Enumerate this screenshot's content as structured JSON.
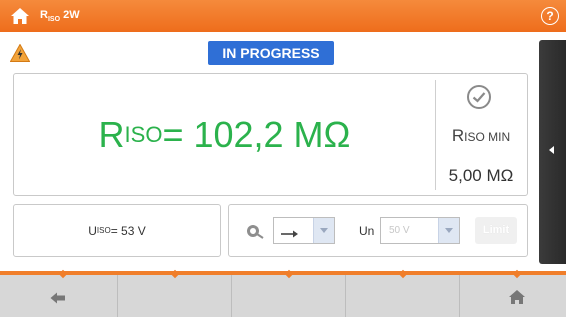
{
  "topbar": {
    "title_main": "R",
    "title_sub": "ISO",
    "title_rest": " 2W",
    "help_label": "?"
  },
  "status": {
    "label": "IN PROGRESS"
  },
  "result": {
    "symbol": "R",
    "symbol_sub": "ISO",
    "value_text": " = 102,2 MΩ"
  },
  "rmin": {
    "symbol": "R",
    "symbol_sub": "ISO MIN",
    "value": "5,00 MΩ"
  },
  "uiso": {
    "symbol": "U",
    "symbol_sub": "ISO",
    "value_text": " = 53 V"
  },
  "settings": {
    "un_label": "Un",
    "un_value": "50 V",
    "limit_label": "Limit"
  },
  "colors": {
    "accent": "#ee6d1c",
    "status_blue": "#2f6fd6",
    "result_green": "#2bb24c"
  },
  "icons": {
    "home": "home-icon",
    "warning": "lightning-warning-icon",
    "check": "check-circle-icon",
    "probe": "probe-icon",
    "direction": "arrow-right-icon",
    "back": "arrow-left-icon"
  }
}
